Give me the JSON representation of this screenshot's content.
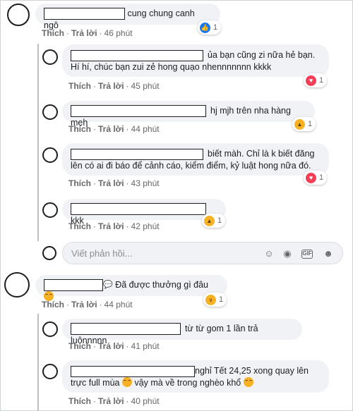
{
  "actions": {
    "like": "Thích",
    "reply": "Trả lời",
    "sep": "·"
  },
  "comments": [
    {
      "text": "cung chung canh ngô",
      "time": "46 phút",
      "reaction": {
        "type": "like-icon",
        "count": "1"
      }
    },
    {
      "text_line1": "ủa bạn cũng zi nữa hẻ bạn.",
      "text_line2": "Hí hí, chúc bạn zui zẻ hong quạo nhennnnnnn kkkk",
      "time": "45 phút",
      "reaction": {
        "type": "love-icon",
        "count": "1"
      }
    },
    {
      "text": "hj mjh trên nha hàng meh",
      "time": "44 phút",
      "reaction": {
        "type": "haha-icon",
        "count": "1"
      }
    },
    {
      "text_line1": "biết màh. Chỉ là k biết đăng",
      "text_line2": "lên có ai đi báo để cảnh cáo, kiểm điểm, kỷ luật hong nữa đó.",
      "time": "43 phút",
      "reaction": {
        "type": "love-icon",
        "count": "1"
      }
    },
    {
      "text": "kkk",
      "time": "42 phút",
      "reaction": {
        "type": "haha-icon",
        "count": "1"
      }
    },
    {
      "text": "Đã được thưởng gì đâu",
      "time": "44 phút",
      "reaction": {
        "type": "sad-icon",
        "count": "1"
      }
    },
    {
      "text": "từ từ gom 1 lần trả luônnnnn",
      "time": "41 phút"
    },
    {
      "text_line1": "nghỉ Tết 24,25 xong quay lên",
      "text_line2a": "trực full mùa",
      "text_line2b": "vậy mà về trong nghèo khổ",
      "time": "40 phút"
    }
  ],
  "reply_box": {
    "placeholder": "Viết phản hồi..."
  }
}
